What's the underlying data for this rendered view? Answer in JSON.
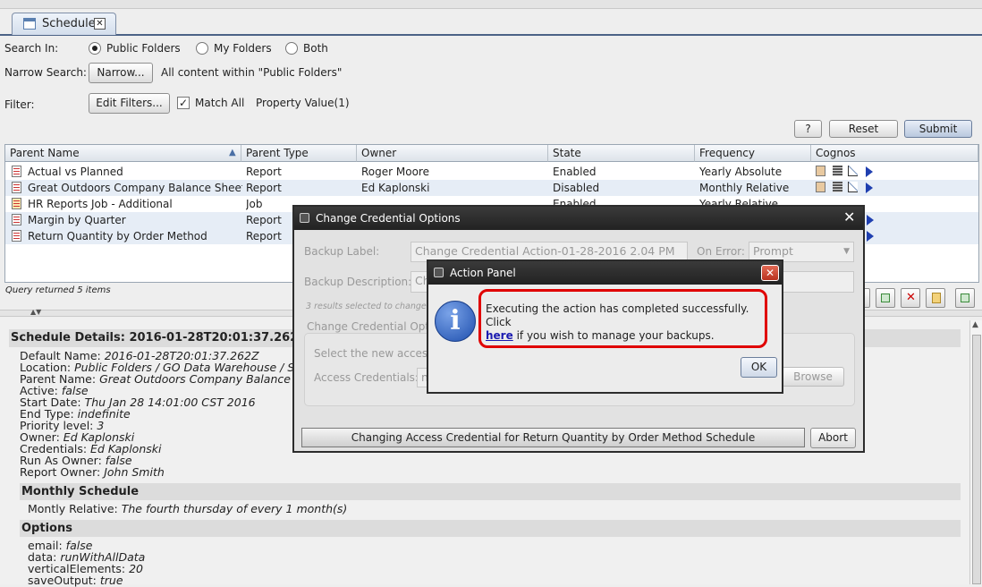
{
  "tab": {
    "label": "Schedule"
  },
  "search": {
    "search_in_label": "Search In:",
    "options": [
      "Public Folders",
      "My Folders",
      "Both"
    ],
    "narrow_label": "Narrow Search:",
    "narrow_button": "Narrow...",
    "narrow_text": "All content within \"Public Folders\"",
    "filter_label": "Filter:",
    "edit_filters_button": "Edit Filters...",
    "match_all_label": "Match All",
    "property_value": "Property Value(1)"
  },
  "actions": {
    "help": "?",
    "reset": "Reset",
    "submit": "Submit"
  },
  "table": {
    "columns": [
      "Parent Name",
      "Parent Type",
      "Owner",
      "State",
      "Frequency",
      "Cognos"
    ],
    "rows": [
      {
        "name": "Actual vs Planned",
        "type": "Report",
        "owner": "Roger Moore",
        "state": "Enabled",
        "frequency": "Yearly Absolute"
      },
      {
        "name": "Great Outdoors Company Balance Sheet...",
        "type": "Report",
        "owner": "Ed Kaplonski",
        "state": "Disabled",
        "frequency": "Monthly Relative"
      },
      {
        "name": "HR Reports Job - Additional",
        "type": "Job",
        "owner": "",
        "state": "Enabled",
        "frequency": "Yearly Relative"
      },
      {
        "name": "Margin by Quarter",
        "type": "Report",
        "owner": "",
        "state": "",
        "frequency": ""
      },
      {
        "name": "Return Quantity by Order Method",
        "type": "Report",
        "owner": "",
        "state": "",
        "frequency": ""
      }
    ],
    "status": "Query returned 5 items"
  },
  "details": {
    "title": "Schedule Details: 2016-01-28T20:01:37.262Z",
    "props": [
      {
        "k": "Default Name:",
        "v": "2016-01-28T20:01:37.262Z"
      },
      {
        "k": "Location:",
        "v": "Public Folders / GO Data Warehouse / Sale"
      },
      {
        "k": "Parent Name:",
        "v": "Great Outdoors Company Balance She"
      },
      {
        "k": "Active:",
        "v": "false"
      },
      {
        "k": "Start Date:",
        "v": "Thu Jan 28 14:01:00 CST 2016"
      },
      {
        "k": "End Type:",
        "v": "indefinite"
      },
      {
        "k": "Priority level:",
        "v": "3"
      },
      {
        "k": "Owner:",
        "v": "Ed Kaplonski"
      },
      {
        "k": "Credentials:",
        "v": "Ed Kaplonski"
      },
      {
        "k": "Run As Owner:",
        "v": "false"
      },
      {
        "k": "Report Owner:",
        "v": "John Smith"
      }
    ],
    "monthly_title": "Monthly Schedule",
    "monthly": {
      "k": "Montly Relative:",
      "v": "The fourth thursday of every 1 month(s)"
    },
    "options_title": "Options",
    "options": [
      {
        "k": "email:",
        "v": "false"
      },
      {
        "k": "data:",
        "v": "runWithAllData"
      },
      {
        "k": "verticalElements:",
        "v": "20"
      },
      {
        "k": "saveOutput:",
        "v": "true"
      }
    ]
  },
  "credential_dialog": {
    "title": "Change Credential Options",
    "backup_label": "Backup Label:",
    "backup_label_value": "Change Credential Action-01-28-2016 2.04 PM",
    "on_error_label": "On Error:",
    "on_error_value": "Prompt",
    "backup_desc_label": "Backup Description:",
    "backup_desc_value": "Ch",
    "selected_text": "3 results selected to change",
    "section_title": "Change Credential Optio",
    "select_text": "Select the new access",
    "access_label": "Access Credentials:",
    "access_value": "n",
    "browse": "Browse",
    "progress_text": "Changing Access Credential for Return Quantity by Order Method Schedule",
    "abort": "Abort"
  },
  "action_panel": {
    "title": "Action Panel",
    "message_before": "Executing the action has completed successfully. Click",
    "link": "here",
    "message_after": "if you wish to manage your backups.",
    "ok": "OK"
  },
  "colors": {
    "accent": "#2a5aa8",
    "highlight": "#e00000",
    "dialog_title": "#2c2c2c"
  }
}
